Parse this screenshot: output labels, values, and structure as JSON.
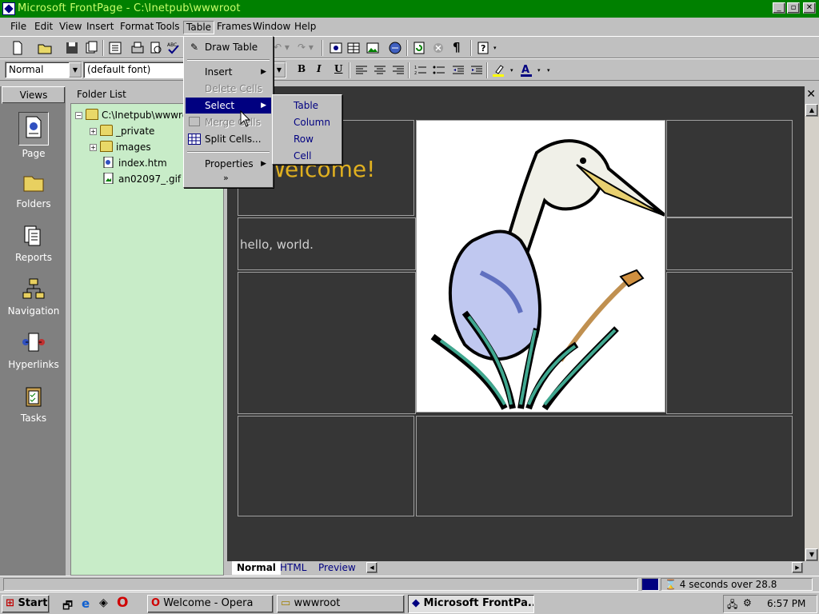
{
  "window": {
    "title": "Microsoft FrontPage - C:\\Inetpub\\wwwroot",
    "controls": [
      "_",
      "□",
      "✕"
    ]
  },
  "menubar": {
    "items": [
      "File",
      "Edit",
      "View",
      "Insert",
      "Format",
      "Tools",
      "Table",
      "Frames",
      "Window",
      "Help"
    ],
    "active": "Table"
  },
  "toolbar": {
    "style_value": "Normal",
    "font_value": "(default font)",
    "bold": "B",
    "italic": "I",
    "underline": "U"
  },
  "table_menu": {
    "items": [
      {
        "label": "Draw Table",
        "disabled": false
      },
      {
        "label": "Insert",
        "disabled": false,
        "submenu": true
      },
      {
        "label": "Delete Cells",
        "disabled": true
      },
      {
        "label": "Select",
        "disabled": false,
        "submenu": true,
        "highlighted": true
      },
      {
        "label": "Merge Cells",
        "disabled": true
      },
      {
        "label": "Split Cells...",
        "disabled": false
      },
      {
        "label": "Properties",
        "disabled": false,
        "submenu": true
      }
    ],
    "more": "»"
  },
  "select_submenu": {
    "items": [
      "Table",
      "Column",
      "Row",
      "Cell"
    ]
  },
  "views": {
    "header": "Views",
    "items": [
      {
        "label": "Page",
        "icon": "page-view-icon",
        "selected": true
      },
      {
        "label": "Folders",
        "icon": "folders-view-icon"
      },
      {
        "label": "Reports",
        "icon": "reports-view-icon"
      },
      {
        "label": "Navigation",
        "icon": "navigation-view-icon"
      },
      {
        "label": "Hyperlinks",
        "icon": "hyperlinks-view-icon"
      },
      {
        "label": "Tasks",
        "icon": "tasks-view-icon"
      }
    ]
  },
  "folder_list": {
    "header": "Folder List",
    "root": "C:\\Inetpub\\wwwroot",
    "items": [
      {
        "label": "_private",
        "type": "folder"
      },
      {
        "label": "images",
        "type": "folder"
      },
      {
        "label": "index.htm",
        "type": "page"
      },
      {
        "label": "an02097_.gif",
        "type": "image"
      }
    ]
  },
  "document": {
    "welcome_text": "Welcome!",
    "body_text": "hello, world."
  },
  "tabs": {
    "items": [
      "Normal",
      "HTML",
      "Preview"
    ],
    "active": "Normal"
  },
  "status": {
    "download_time": "4 seconds over 28.8"
  },
  "taskbar": {
    "start": "Start",
    "buttons": [
      {
        "label": "Welcome - Opera",
        "pressed": false
      },
      {
        "label": "wwwroot",
        "pressed": false
      },
      {
        "label": "Microsoft FrontPa...",
        "pressed": true
      }
    ],
    "clock": "6:57 PM"
  },
  "colors": {
    "titlebar": "#008000",
    "editor_bg": "#363636",
    "folder_bg": "#c8ecc8",
    "menu_highlight": "#000080",
    "welcome": "#e0b020"
  }
}
